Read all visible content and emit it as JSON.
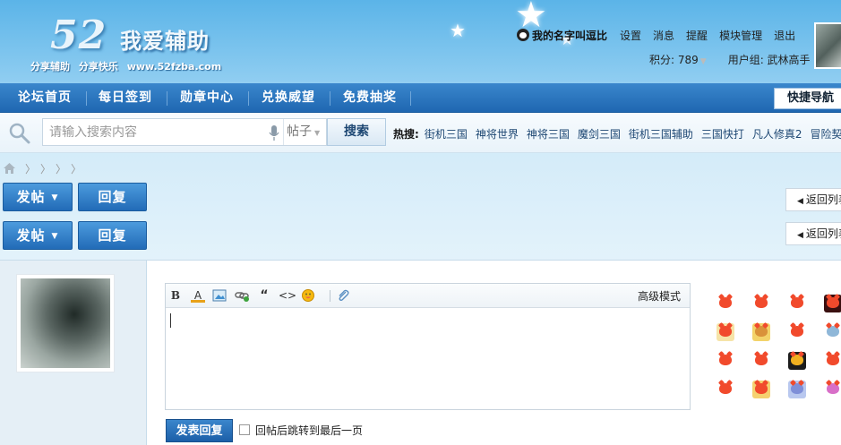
{
  "logo": {
    "number": "52",
    "title": "我爱辅助",
    "tag1": "分享辅助",
    "tag2": "分享快乐",
    "url": "www.52fzba.com"
  },
  "user": {
    "name": "我的名字叫逗比",
    "links": [
      "设置",
      "消息",
      "提醒",
      "模块管理",
      "退出"
    ],
    "points_label": "积分: 789",
    "group_label": "用户组: 武林高手"
  },
  "nav": {
    "items": [
      "论坛首页",
      "每日签到",
      "勋章中心",
      "兑换威望",
      "免费抽奖"
    ],
    "quick_nav": "快捷导航"
  },
  "search": {
    "placeholder": "请输入搜索内容",
    "type": "帖子",
    "button": "搜索",
    "hot_label": "热搜:",
    "hot_items": [
      "街机三国",
      "神将世界",
      "神将三国",
      "魔剑三国",
      "街机三国辅助",
      "三国快打",
      "凡人修真2",
      "冒险契约"
    ]
  },
  "actions": {
    "post": "发帖",
    "reply": "回复",
    "back": "返回列表"
  },
  "editor": {
    "toolbar": [
      "bold-icon",
      "font-color-icon",
      "image-icon",
      "link-icon",
      "quote-icon",
      "code-icon",
      "smiley-icon",
      "attachment-icon"
    ],
    "advanced_mode": "高级模式",
    "submit": "发表回复",
    "checkbox_label": "回帖后跳转到最后一页",
    "checkbox_checked": false
  },
  "colors": {
    "nav_bg": "#2a74bd",
    "accent": "#1c5fa8",
    "link": "#1c4672",
    "smiley": "#f14a2c"
  }
}
